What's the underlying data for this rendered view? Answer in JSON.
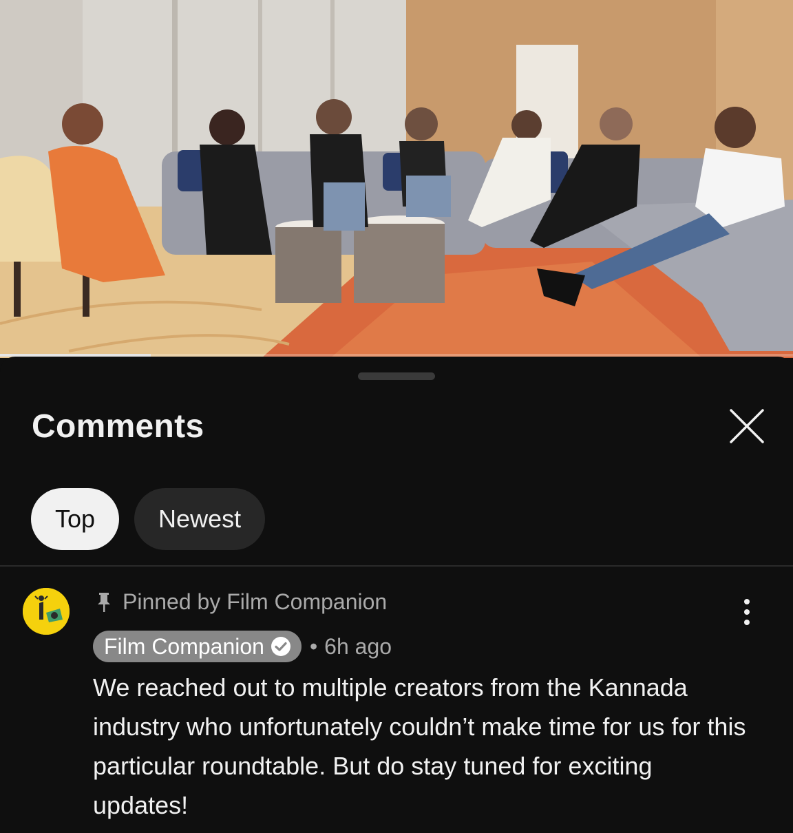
{
  "video": {
    "progress_fraction": 0.19
  },
  "comments_panel": {
    "title": "Comments",
    "close_icon": "close-icon",
    "filters": [
      {
        "label": "Top",
        "selected": true
      },
      {
        "label": "Newest",
        "selected": false
      }
    ]
  },
  "pinned_comment": {
    "pinned_label": "Pinned by Film Companion",
    "pin_icon": "pin-icon",
    "author": "Film Companion",
    "verified_icon": "verified-check-icon",
    "separator": "•",
    "time": "6h ago",
    "text": "We reached out to multiple creators from the Kannada industry who unfortunately couldn’t make time for us for this particular roundtable. But do stay tuned for exciting updates!",
    "menu_icon": "more-vert-icon"
  },
  "colors": {
    "background": "#0f0f0f",
    "chip_active": "#f1f1f1",
    "chip_inactive": "#272727",
    "avatar": "#f5d10d",
    "author_chip": "#888888"
  }
}
